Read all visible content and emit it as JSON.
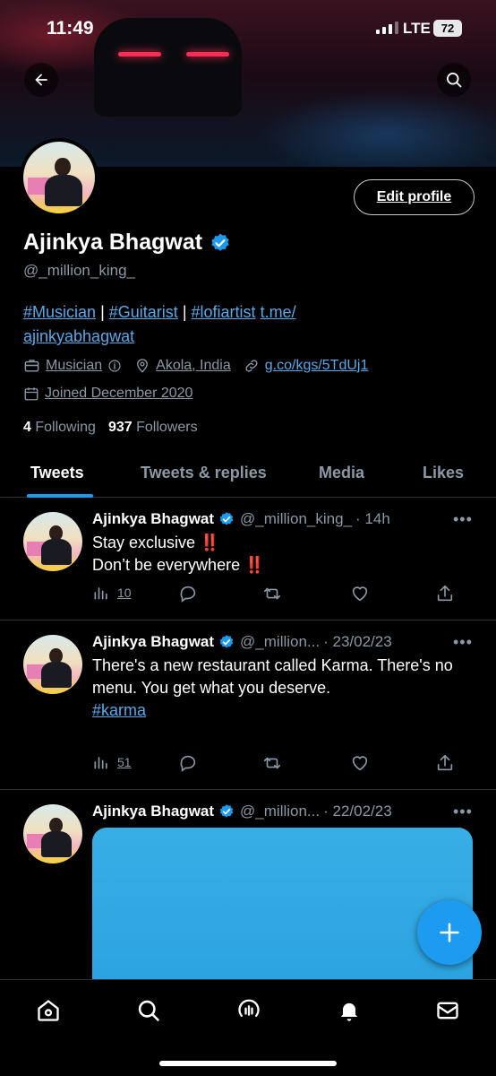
{
  "status_bar": {
    "time": "11:49",
    "network": "LTE",
    "battery": "72"
  },
  "profile": {
    "name": "Ajinkya Bhagwat",
    "handle": "@_million_king_",
    "edit_label": "Edit profile",
    "bio_tags": [
      "#Musician",
      "#Guitarist",
      "#lofiartist"
    ],
    "bio_separator": "|",
    "bio_link_line1": "t.me/",
    "bio_link_line2": "ajinkyabhagwat",
    "profession": "Musician",
    "location": "Akola, India",
    "website": "g.co/kgs/5TdUj1",
    "joined": "Joined December 2020",
    "following_count": "4",
    "following_label": "Following",
    "followers_count": "937",
    "followers_label": "Followers"
  },
  "tabs": [
    "Tweets",
    "Tweets & replies",
    "Media",
    "Likes"
  ],
  "tweets": [
    {
      "name": "Ajinkya Bhagwat",
      "handle": "@_million_king_",
      "time": "· 14h",
      "line1": "Stay exclusive",
      "line2": "Don’t be everywhere",
      "emoji": "‼️",
      "views": "10"
    },
    {
      "name": "Ajinkya Bhagwat",
      "handle": "@_million...",
      "time": "· 23/02/23",
      "text": "There's a new restaurant called Karma. There's no menu. You get what you deserve.",
      "hashtag": "#karma",
      "views": "51"
    },
    {
      "name": "Ajinkya Bhagwat",
      "handle": "@_million...",
      "time": "· 22/02/23"
    }
  ],
  "more_icon": "•••",
  "colors": {
    "accent": "#1d9bf0",
    "link": "#5aa8e6",
    "muted": "#8b98a5",
    "background": "#000000"
  },
  "icons": [
    "back-arrow-icon",
    "search-icon",
    "verified-badge-icon",
    "briefcase-icon",
    "info-icon",
    "location-pin-icon",
    "link-icon",
    "calendar-icon",
    "views-icon",
    "reply-icon",
    "retweet-icon",
    "like-icon",
    "share-icon",
    "compose-plus-icon",
    "home-icon",
    "spaces-icon",
    "bell-icon",
    "mail-icon"
  ]
}
